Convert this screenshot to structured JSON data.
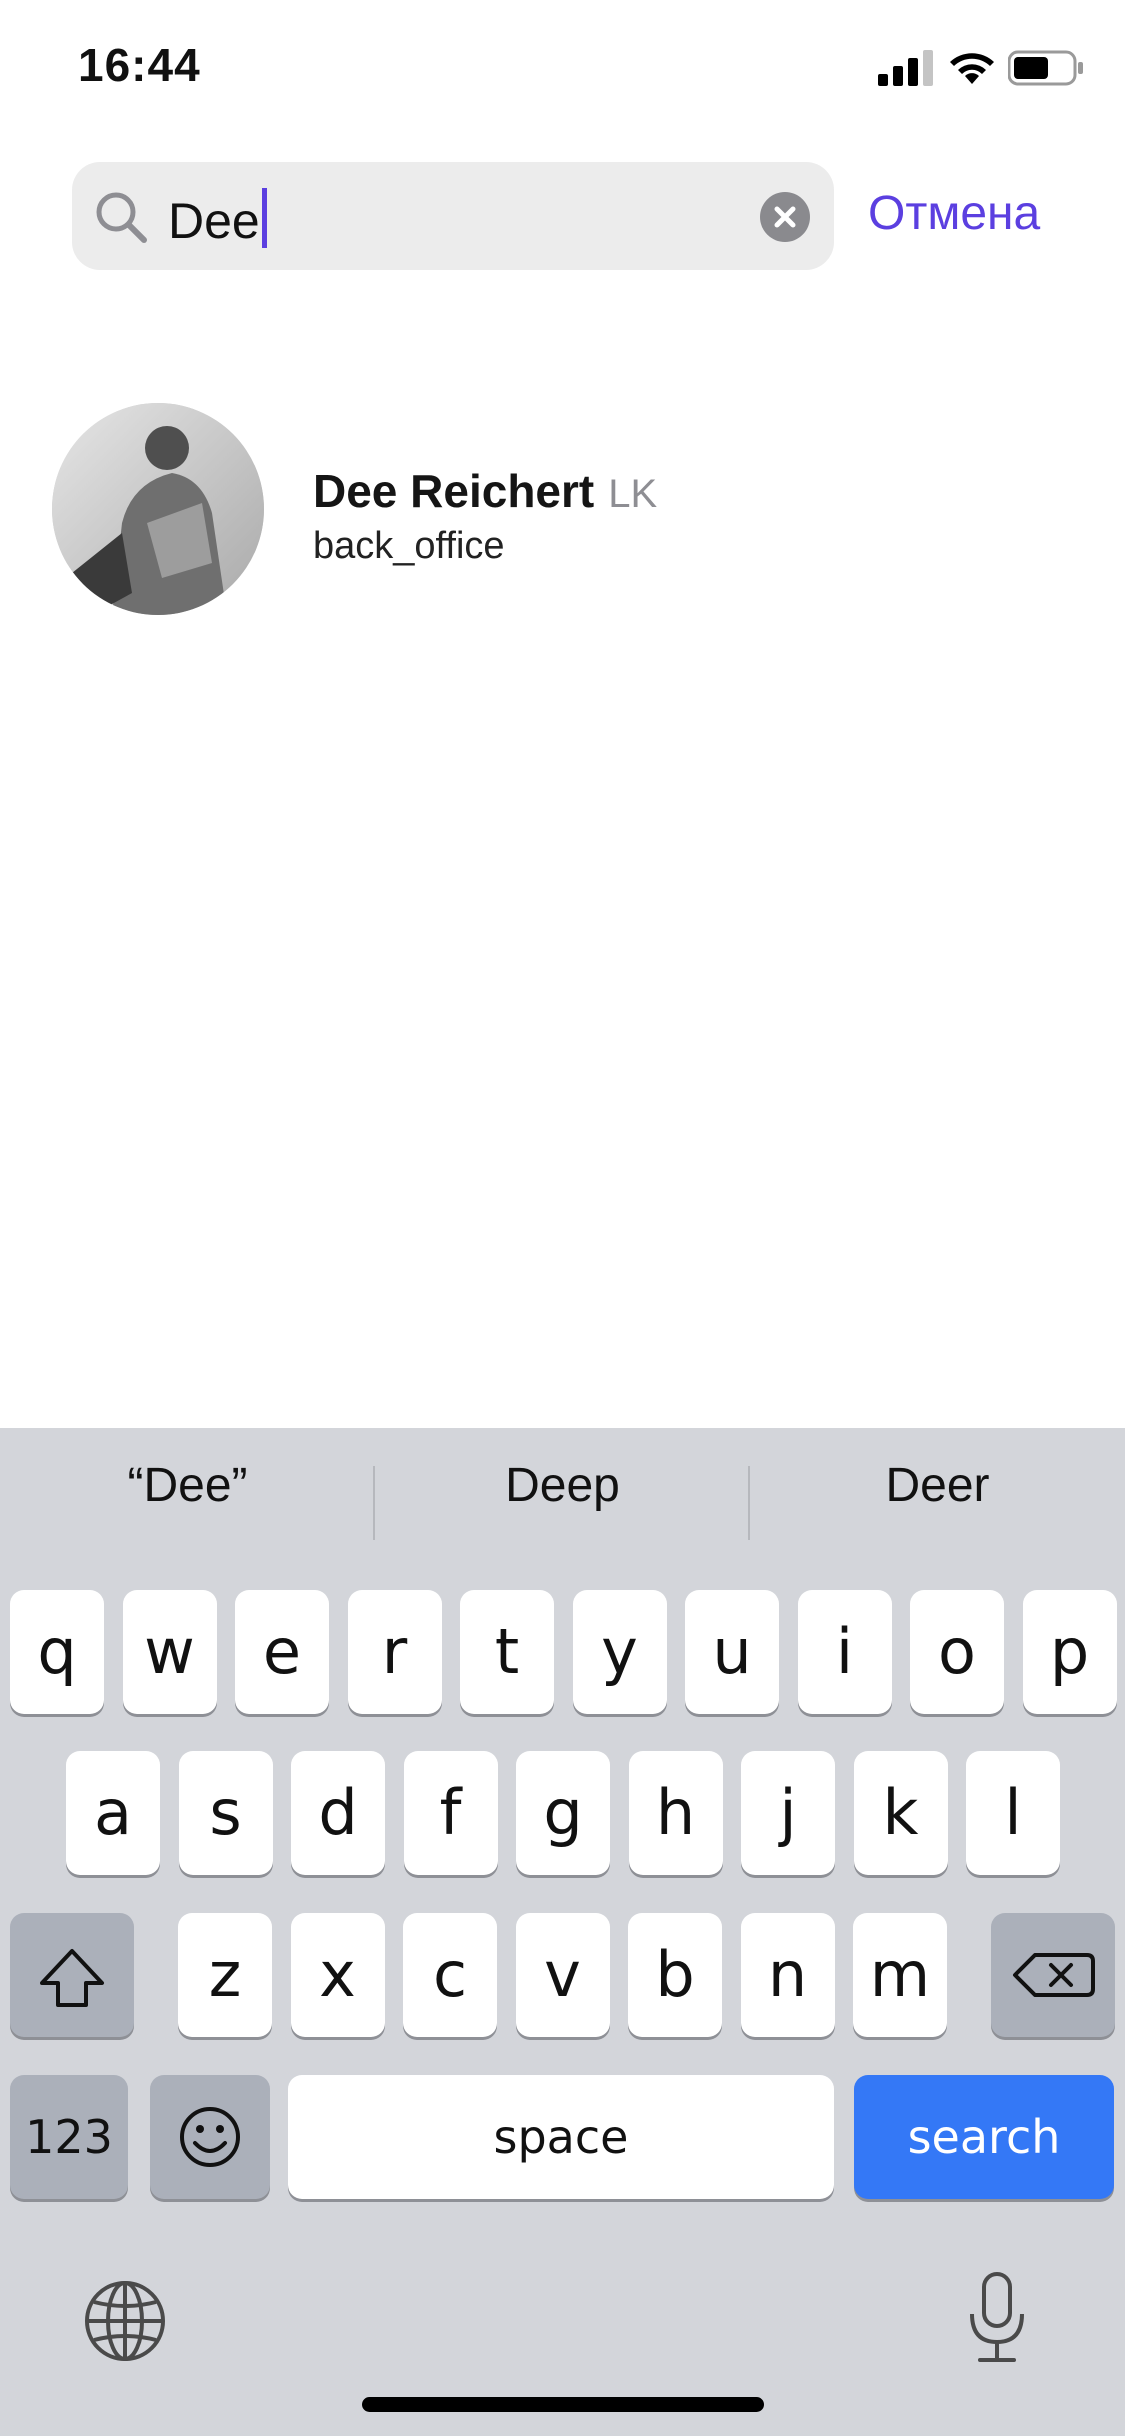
{
  "status_bar": {
    "time": "16:44"
  },
  "search": {
    "query": "Dee",
    "cancel_label": "Отмена"
  },
  "results": [
    {
      "name": "Dee Reichert",
      "tag": "LK",
      "subtitle": "back_office"
    }
  ],
  "keyboard": {
    "suggestions": [
      "“Dee”",
      "Deep",
      "Deer"
    ],
    "row1": [
      "q",
      "w",
      "e",
      "r",
      "t",
      "y",
      "u",
      "i",
      "o",
      "p"
    ],
    "row2": [
      "a",
      "s",
      "d",
      "f",
      "g",
      "h",
      "j",
      "k",
      "l"
    ],
    "row3": [
      "z",
      "x",
      "c",
      "v",
      "b",
      "n",
      "m"
    ],
    "numbers_label": "123",
    "space_label": "space",
    "search_label": "search",
    "icons": [
      "shift-icon",
      "backspace-icon",
      "emoji-icon",
      "globe-icon",
      "microphone-icon"
    ]
  },
  "colors": {
    "accent": "#5b3fe0",
    "search_key": "#3478f6",
    "keyboard_bg": "#d3d5da"
  }
}
